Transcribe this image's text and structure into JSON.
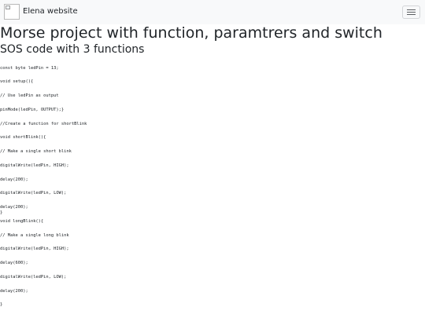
{
  "navbar": {
    "brand": "Elena website",
    "logo_icon": "broken-image-icon",
    "toggle_icon": "hamburger-menu-icon"
  },
  "main": {
    "title": "Morse project with function, paramtrers and switch",
    "subtitle": "SOS code with 3 functions",
    "code_lines": [
      "const byte ledPin = 13;",
      "void setup(){",
      "// Use ledPin as output",
      "pinMode(ledPin, OUTPUT);}",
      "//Create a function for shortBlink",
      "void shortBlink(){",
      "// Make a single short blink",
      "digitalWrite(ledPin, HIGH);",
      "delay(200);",
      "digitalWrite(ledPin, LOW);",
      "delay(200);",
      "}",
      "void longBlink(){",
      "// Make a single long blink",
      "digitalWrite(ledPin, HIGH);",
      "delay(600);",
      "digitalWrite(ledPin, LOW);",
      "delay(200);",
      "}"
    ]
  }
}
